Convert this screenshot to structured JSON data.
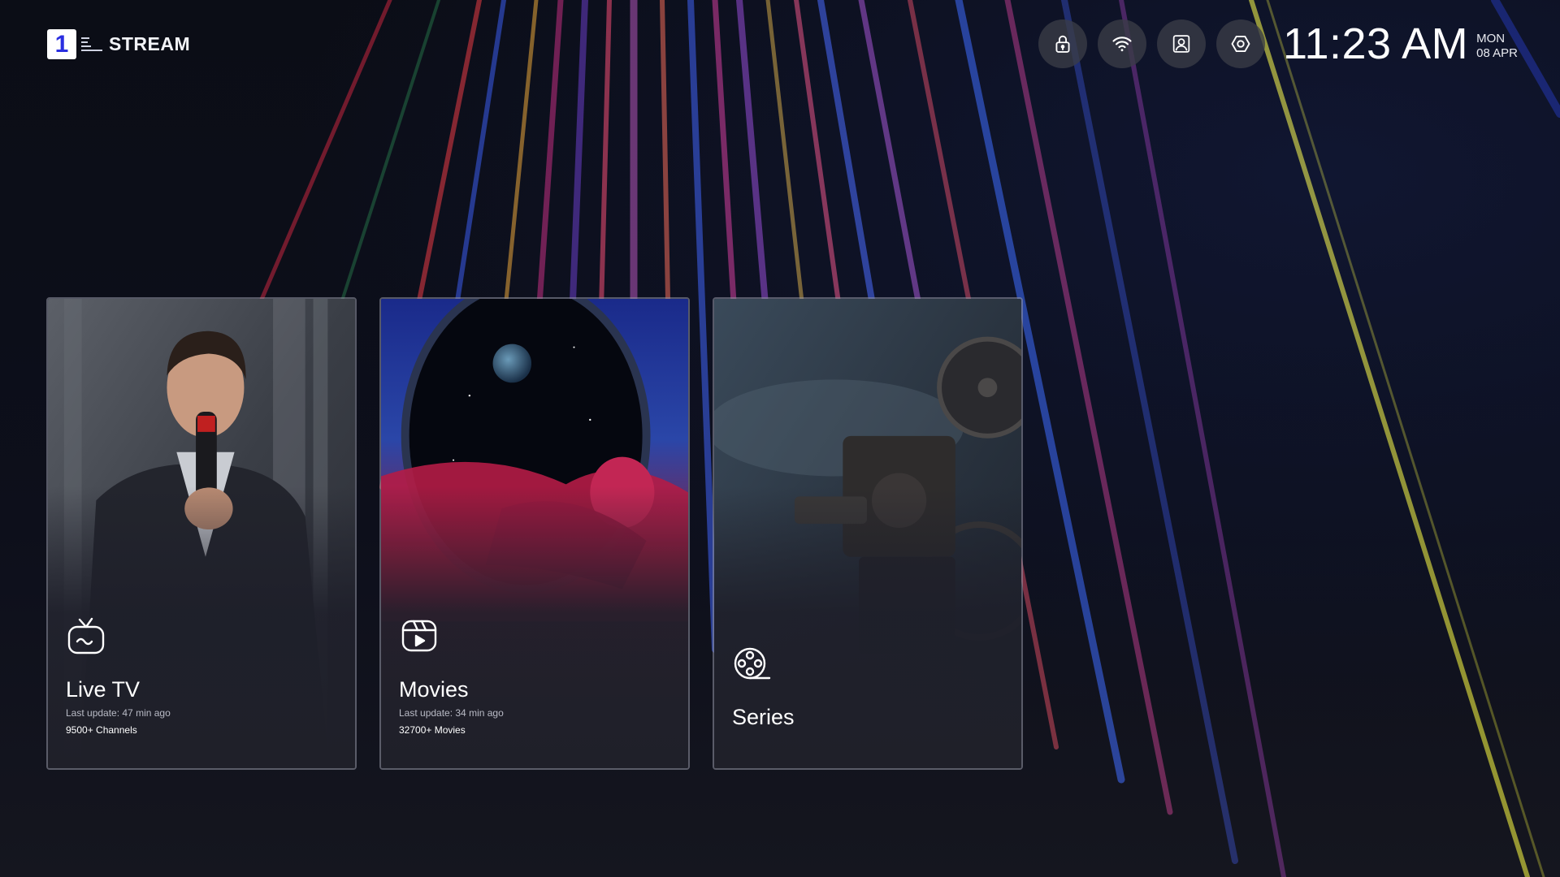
{
  "app": {
    "logo_mark": "1",
    "logo_text": "STREAM"
  },
  "topbar": {
    "buttons": [
      {
        "name": "lock",
        "icon": "lock-icon"
      },
      {
        "name": "wifi",
        "icon": "wifi-icon"
      },
      {
        "name": "profile",
        "icon": "profile-card-icon"
      },
      {
        "name": "settings",
        "icon": "settings-icon"
      }
    ],
    "time": "11:23 AM",
    "day": "MON",
    "date": "08 APR"
  },
  "cards": [
    {
      "title": "Live TV",
      "update": "Last update: 47 min ago",
      "count": "9500+ Channels",
      "icon": "tv-icon"
    },
    {
      "title": "Movies",
      "update": "Last update: 34 min ago",
      "count": "32700+ Movies",
      "icon": "movie-play-icon"
    },
    {
      "title": "Series",
      "update": "",
      "count": "",
      "icon": "film-reel-icon"
    }
  ],
  "colors": {
    "background": "#0b0d16",
    "card_border": "#96989f",
    "logo_accent": "#2a2ee0",
    "button_bg": "#3a3c46"
  }
}
